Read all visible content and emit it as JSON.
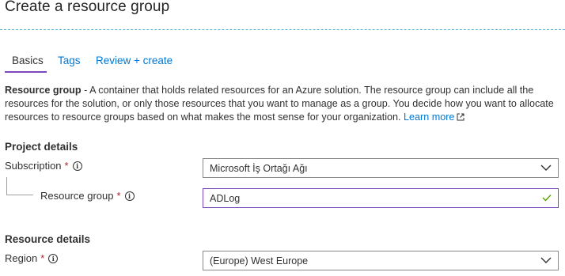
{
  "page": {
    "title": "Create a resource group"
  },
  "tabs": [
    {
      "label": "Basics",
      "active": true
    },
    {
      "label": "Tags",
      "active": false
    },
    {
      "label": "Review + create",
      "active": false
    }
  ],
  "description": {
    "bold": "Resource group",
    "text": " - A container that holds related resources for an Azure solution. The resource group can include all the resources for the solution, or only those resources that you want to manage as a group. You decide how you want to allocate resources to resource groups based on what makes the most sense for your organization. ",
    "link": "Learn more"
  },
  "project_details": {
    "heading": "Project details",
    "subscription": {
      "label": "Subscription",
      "required": "*",
      "value": "Microsoft İş Ortağı Ağı"
    },
    "resource_group": {
      "label": "Resource group",
      "required": "*",
      "value": "ADLog"
    }
  },
  "resource_details": {
    "heading": "Resource details",
    "region": {
      "label": "Region",
      "required": "*",
      "value": "(Europe) West Europe"
    }
  },
  "colors": {
    "accent": "#0078d4",
    "focus": "#7a48b8",
    "required": "#a4262c",
    "valid": "#57a300"
  },
  "icons": {
    "info": "info-icon",
    "chevron": "chevron-down-icon",
    "check": "checkmark-icon",
    "external": "external-link-icon"
  }
}
